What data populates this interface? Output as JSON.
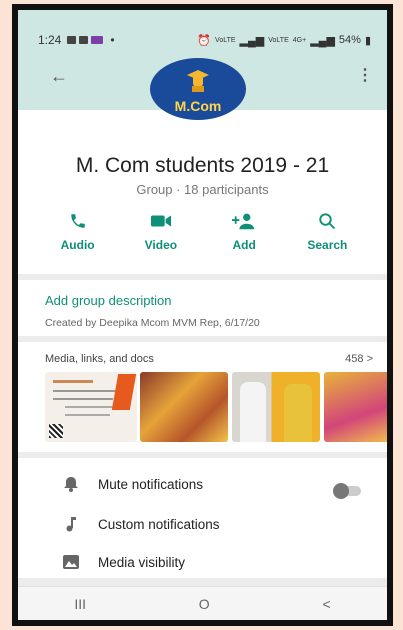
{
  "status_bar": {
    "time": "1:24",
    "network_left": "VoLTE",
    "network_right": "VoLTE",
    "network_right_tag": "4G+",
    "battery": "54%"
  },
  "group": {
    "avatar_label": "M.Com",
    "name": "M. Com students 2019 - 21",
    "subtitle": "Group · 18 participants"
  },
  "actions": [
    {
      "label": "Audio",
      "icon": "phone-icon"
    },
    {
      "label": "Video",
      "icon": "video-icon"
    },
    {
      "label": "Add",
      "icon": "add-person-icon"
    },
    {
      "label": "Search",
      "icon": "search-icon"
    }
  ],
  "description": {
    "link": "Add group description",
    "created": "Created by Deepika Mcom MVM Rep, 6/17/20"
  },
  "media": {
    "heading": "Media, links, and docs",
    "count": "458 >"
  },
  "settings": [
    {
      "label": "Mute notifications",
      "icon": "bell-icon"
    },
    {
      "label": "Custom notifications",
      "icon": "music-note-icon"
    },
    {
      "label": "Media visibility",
      "icon": "image-icon"
    }
  ],
  "mute_toggle_on": false,
  "nav": {
    "recent": "III",
    "home": "O",
    "back": "<"
  },
  "colors": {
    "accent": "#0e8f77",
    "header_bg": "#cfe7e2",
    "avatar_bg": "#1a4a9a",
    "page_bg": "#fbe3d6"
  }
}
